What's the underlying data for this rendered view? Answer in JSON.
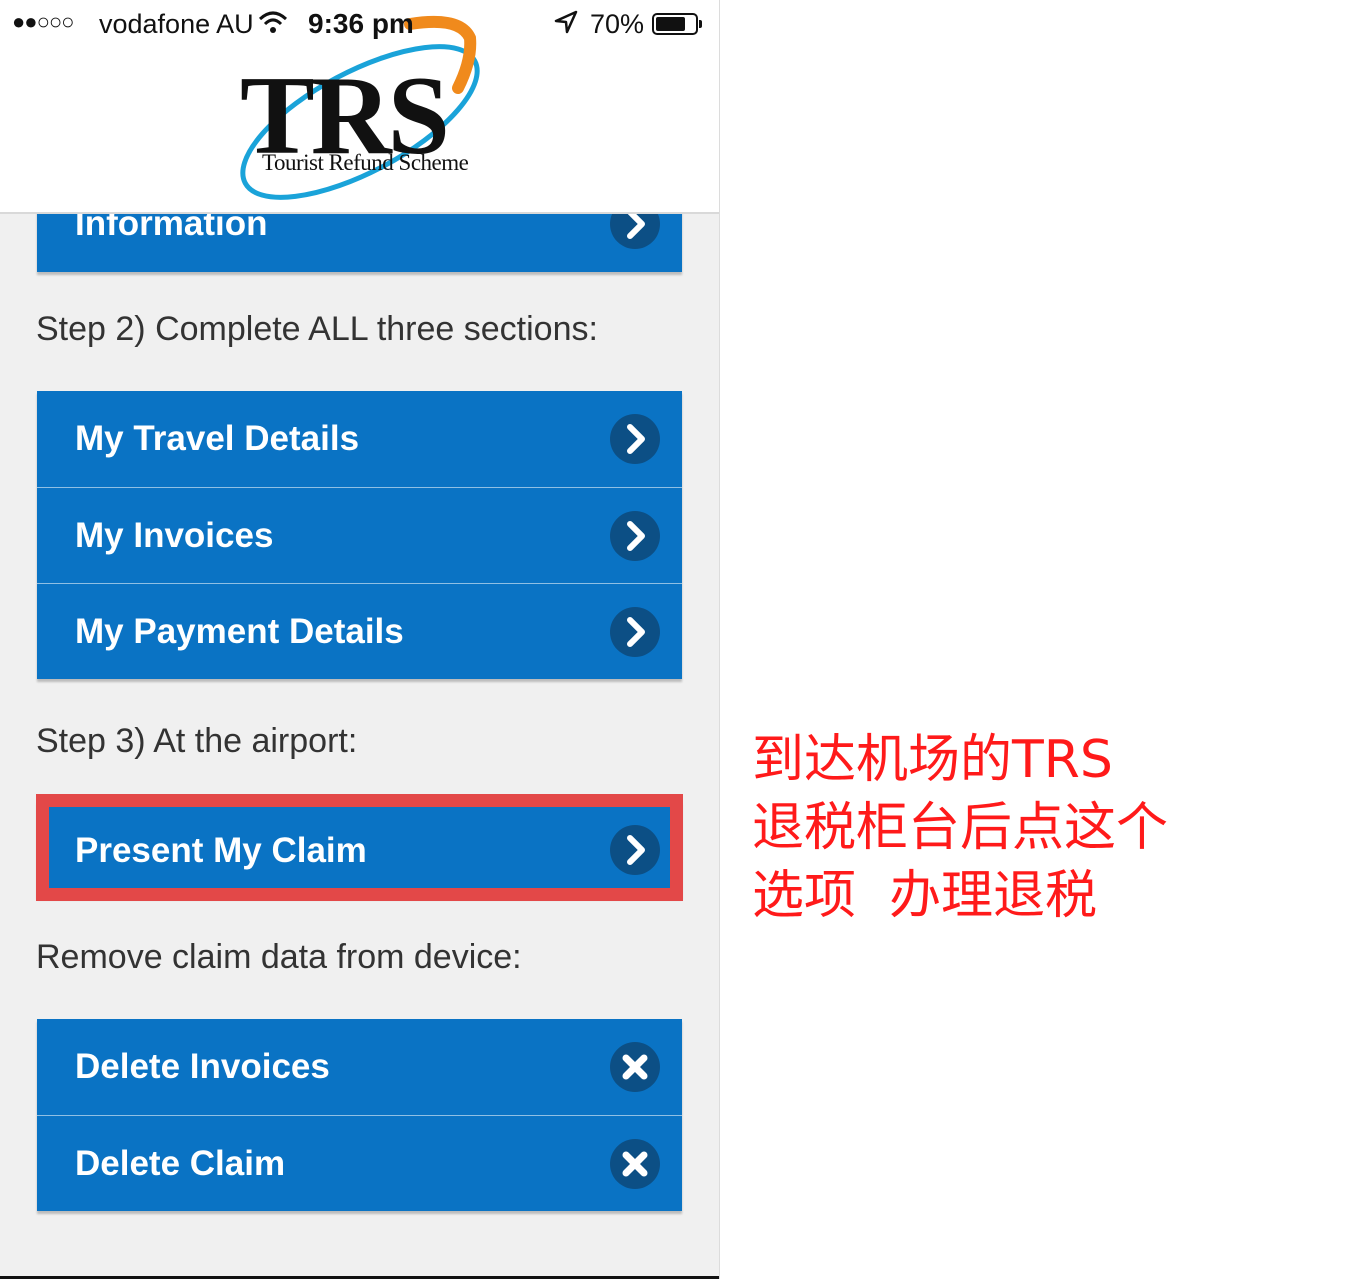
{
  "status_bar": {
    "signal": "●●○○○",
    "carrier": "vodafone AU",
    "time": "9:36 pm",
    "battery": "70%",
    "battery_level": 0.7
  },
  "header": {
    "logo_text": "TRS",
    "logo_tagline": "Tourist Refund Scheme"
  },
  "top_button": {
    "label": "Information"
  },
  "step2": {
    "heading": "Step 2) Complete ALL three sections:",
    "buttons": [
      {
        "label": "My Travel Details"
      },
      {
        "label": "My Invoices"
      },
      {
        "label": "My Payment Details"
      }
    ]
  },
  "step3": {
    "heading": "Step 3) At the airport:",
    "button": {
      "label": "Present My Claim"
    }
  },
  "remove": {
    "heading": "Remove claim data from device:",
    "buttons": [
      {
        "label": "Delete Invoices"
      },
      {
        "label": "Delete Claim"
      }
    ]
  },
  "annotation": {
    "text": "到达机场的TRS\n退税柜台后点这个\n选项  办理退税",
    "color": "#ff1a1a"
  },
  "colors": {
    "button": "#0a73c4",
    "icon_circle": "#0c4f85",
    "highlight": "#e34848",
    "background": "#f0f0f0"
  },
  "icons": {
    "chevron": "chevron-right-icon",
    "delete": "close-icon"
  }
}
